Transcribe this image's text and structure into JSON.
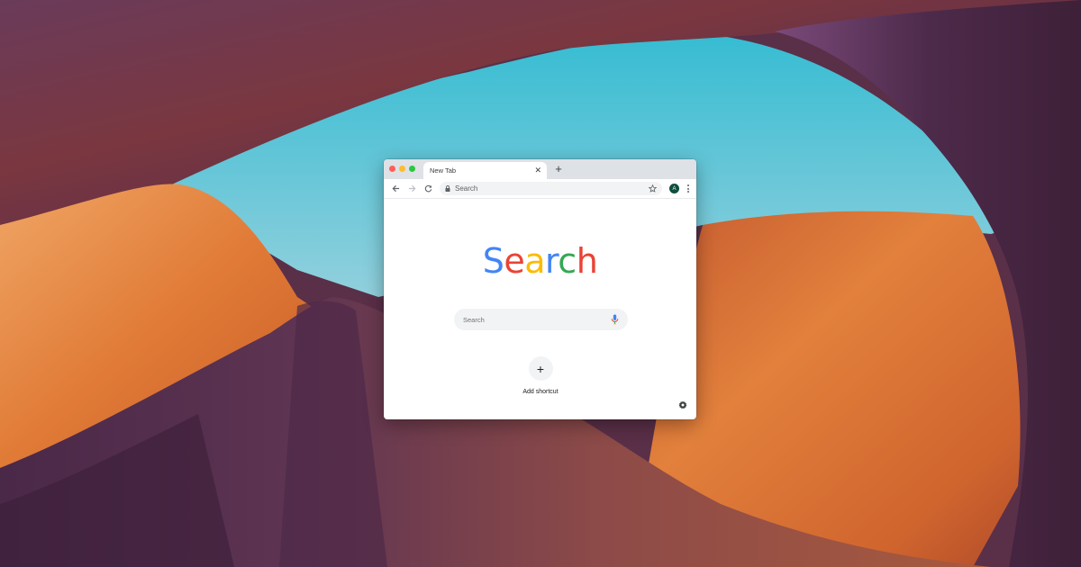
{
  "wallpaper": {
    "description": "Antelope canyon sandstone arch with blue sky",
    "colors": {
      "sky_top": "#3bbfd3",
      "sky_bottom": "#8fcfdc",
      "rock_purple": "#5b3150",
      "rock_dark": "#3a1f35",
      "rock_red": "#8a3c3a",
      "sand_orange": "#e0793a",
      "sand_light": "#f0a05e"
    }
  },
  "browser": {
    "traffic_lights": [
      "close",
      "minimize",
      "maximize"
    ],
    "tabs": [
      {
        "title": "New Tab",
        "active": true,
        "close_icon": "close-icon"
      }
    ],
    "new_tab_label": "+",
    "toolbar": {
      "back_icon": "arrow-left-icon",
      "forward_icon": "arrow-right-icon",
      "reload_icon": "reload-icon",
      "omnibox_icon": "lock-icon",
      "omnibox_placeholder": "Search",
      "bookmark_icon": "star-icon",
      "profile_initial": "A",
      "menu_icon": "kebab-menu-icon"
    },
    "page": {
      "logo_letters": [
        {
          "char": "S",
          "color": "#4285f4"
        },
        {
          "char": "e",
          "color": "#ea4335"
        },
        {
          "char": "a",
          "color": "#fbbc05"
        },
        {
          "char": "r",
          "color": "#4285f4"
        },
        {
          "char": "c",
          "color": "#34a853"
        },
        {
          "char": "h",
          "color": "#ea4335"
        }
      ],
      "search_placeholder": "Search",
      "shortcut": {
        "icon": "+",
        "label": "Add shortcut"
      },
      "customize_icon": "gear-icon"
    }
  }
}
